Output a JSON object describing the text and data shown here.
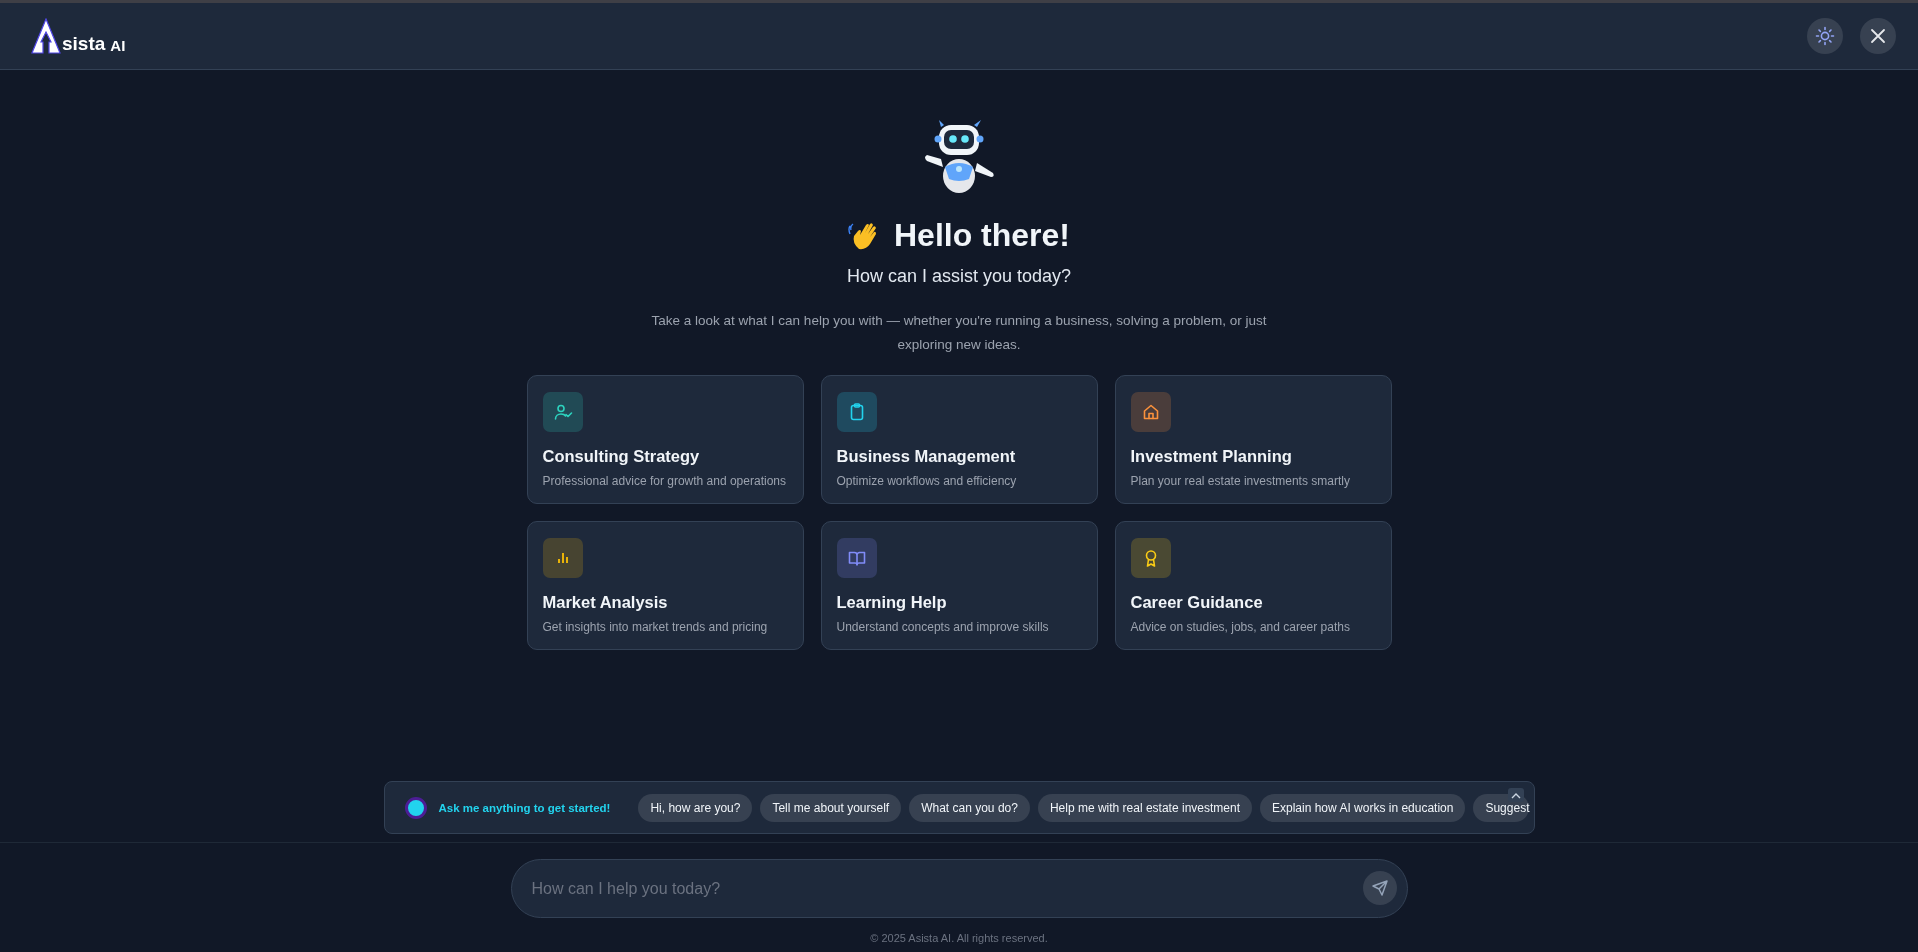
{
  "header": {
    "logo_text": "sista",
    "logo_suffix": "AI"
  },
  "hero": {
    "title": "Hello there!",
    "subtitle": "How can I assist you today?",
    "description": "Take a look at what I can help you with — whether you're running a business, solving a problem, or just exploring new ideas."
  },
  "cards": [
    {
      "title": "Consulting Strategy",
      "description": "Professional advice for growth and operations",
      "color": "#2dd4bf"
    },
    {
      "title": "Business Management",
      "description": "Optimize workflows and efficiency",
      "color": "#22d3ee"
    },
    {
      "title": "Investment Planning",
      "description": "Plan your real estate investments smartly",
      "color": "#fb923c"
    },
    {
      "title": "Market Analysis",
      "description": "Get insights into market trends and pricing",
      "color": "#eab308"
    },
    {
      "title": "Learning Help",
      "description": "Understand concepts and improve skills",
      "color": "#818cf8"
    },
    {
      "title": "Career Guidance",
      "description": "Advice on studies, jobs, and career paths",
      "color": "#facc15"
    }
  ],
  "suggestions": {
    "prompt": "Ask me anything to get started!",
    "chips": [
      "Hi, how are you?",
      "Tell me about yourself",
      "What can you do?",
      "Help me with real estate investment",
      "Explain how AI works in education",
      "Suggest"
    ]
  },
  "composer": {
    "placeholder": "How can I help you today?"
  },
  "footer": {
    "copyright": "© 2025 Asista AI. All rights reserved."
  }
}
